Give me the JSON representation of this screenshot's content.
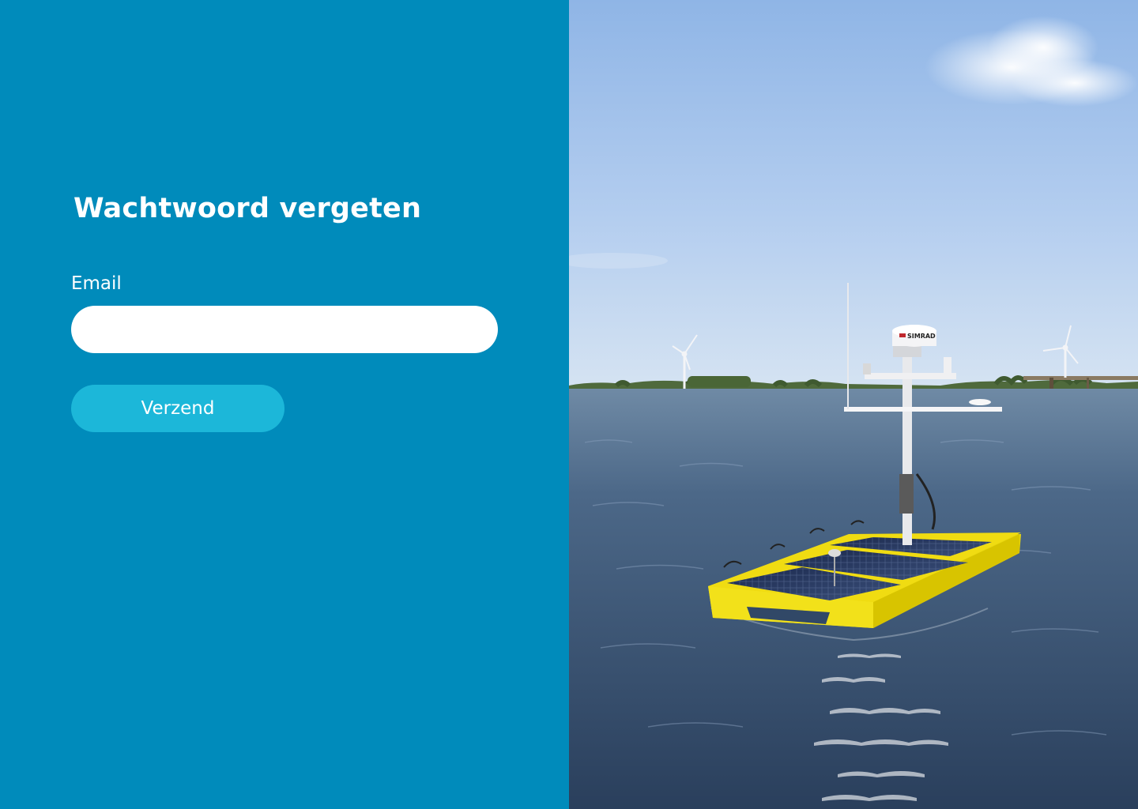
{
  "form": {
    "title": "Wachtwoord vergeten",
    "email_label": "Email",
    "email_value": "",
    "email_placeholder": "",
    "submit_label": "Verzend"
  },
  "photo": {
    "subject": "solar-powered-survey-boat-on-water",
    "radome_brand": "SIMRAD"
  },
  "colors": {
    "panel_background": "#008bbb",
    "button_background": "#1cb7d9",
    "input_background": "#ffffff",
    "text": "#ffffff"
  }
}
